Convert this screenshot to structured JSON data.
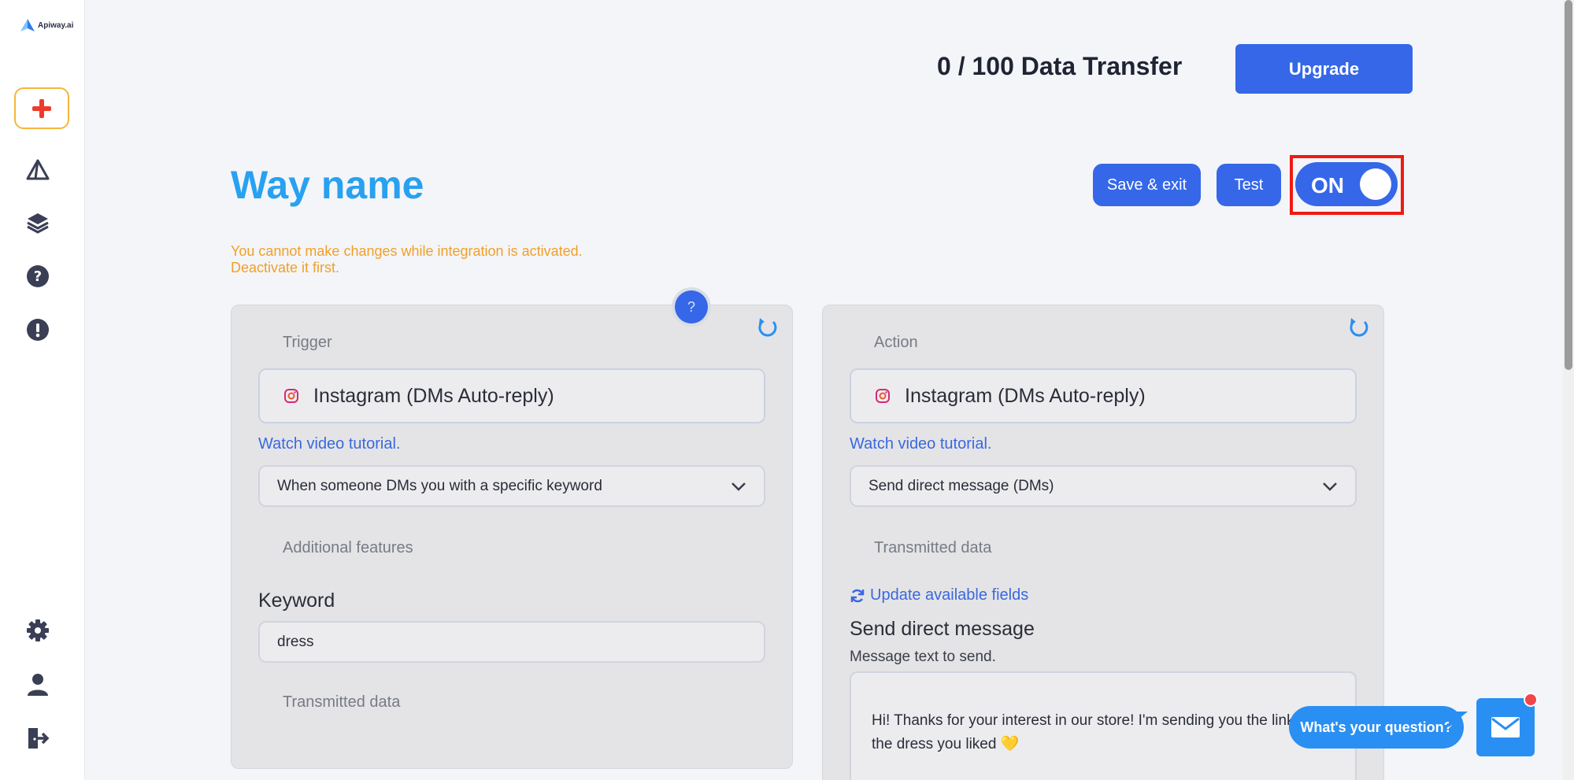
{
  "app": {
    "logo_text": "Apiway.ai"
  },
  "header": {
    "usage_text": "0 / 100 Data Transfer",
    "upgrade_label": "Upgrade"
  },
  "way": {
    "title": "Way name",
    "warning": "You cannot make changes while integration is activated. Deactivate it first.",
    "save_exit_label": "Save & exit",
    "test_label": "Test",
    "toggle_label": "ON",
    "help_label": "?"
  },
  "trigger": {
    "section_label": "Trigger",
    "app_name": "Instagram (DMs Auto-reply)",
    "tutorial_link": "Watch video tutorial.",
    "event": "When someone DMs you with a specific keyword",
    "additional_label": "Additional features",
    "keyword_title": "Keyword",
    "keyword_value": "dress",
    "transmitted_label": "Transmitted data"
  },
  "action": {
    "section_label": "Action",
    "app_name": "Instagram (DMs Auto-reply)",
    "tutorial_link": "Watch video tutorial.",
    "event": "Send direct message (DMs)",
    "transmitted_label": "Transmitted data",
    "update_fields_link": "Update available fields",
    "message_title": "Send direct message",
    "message_hint": "Message text to send.",
    "message_value": "Hi! Thanks for your interest in our store! I'm sending you the link to the dress you liked 💛"
  },
  "chat": {
    "prompt": "What's your question?"
  },
  "colors": {
    "accent": "#3567e8",
    "title": "#28a1f0",
    "warning": "#f0a028",
    "highlight": "#f01a10"
  }
}
